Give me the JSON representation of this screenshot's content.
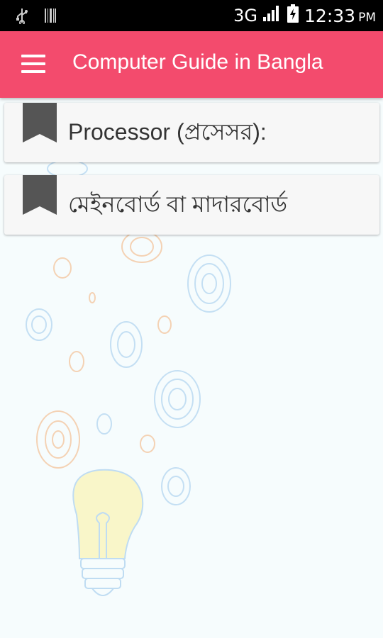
{
  "status_bar": {
    "network": "3G",
    "time": "12:33",
    "ampm": "PM",
    "icons": [
      "usb-icon",
      "barcode-icon",
      "signal-icon",
      "battery-charging-icon"
    ]
  },
  "app_bar": {
    "title": "Computer Guide in Bangla",
    "menu_icon": "hamburger-menu-icon",
    "color": "#f34b6d"
  },
  "list": {
    "items": [
      {
        "label": "Processor (প্রসেসর):",
        "icon": "bookmark-icon"
      },
      {
        "label": "মেইনবোর্ড বা মাদারবোর্ড",
        "icon": "bookmark-icon"
      }
    ]
  },
  "background": {
    "illustration": "lightbulb-doodle-background"
  }
}
